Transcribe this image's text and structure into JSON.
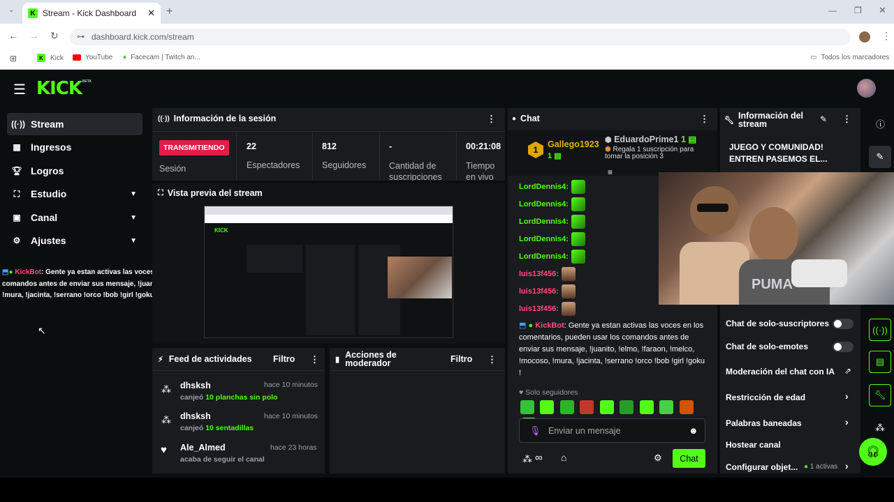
{
  "browser": {
    "tab_title": "Stream - Kick Dashboard",
    "url": "dashboard.kick.com/stream",
    "bookmarks": [
      "Kick",
      "YouTube",
      "Facecam | Twitch an..."
    ],
    "all_bookmarks": "Todos los marcadores"
  },
  "app": {
    "logo": "KICK",
    "logo_badge": "BETA"
  },
  "sidebar": {
    "items": [
      {
        "label": "Stream",
        "icon": "broadcast-icon"
      },
      {
        "label": "Ingresos",
        "icon": "chart-icon"
      },
      {
        "label": "Logros",
        "icon": "trophy-icon"
      },
      {
        "label": "Estudio",
        "icon": "studio-icon"
      },
      {
        "label": "Canal",
        "icon": "channel-icon"
      },
      {
        "label": "Ajustes",
        "icon": "gear-icon"
      }
    ]
  },
  "overlay_message": {
    "user": "KickBot",
    "text": ": Gente ya estan activas las voces en los comentarios, pueden usar los comandos antes de enviar sus mensaje, !juanito, !elmo, !faraon, !melco, !mocoso, !mura, !jacinta, !serrano !orco !bob !girl !goku !"
  },
  "session": {
    "title": "Información de la sesión",
    "status": "TRANSMITIENDO",
    "status_label": "Sesión",
    "stats": [
      {
        "value": "22",
        "label": "Espectadores"
      },
      {
        "value": "812",
        "label": "Seguidores"
      },
      {
        "value": "-",
        "label": "Cantidad de suscripciones"
      },
      {
        "value": "00:21:08",
        "label": "Tiempo en vivo"
      }
    ]
  },
  "preview": {
    "title": "Vista previa del stream"
  },
  "feed": {
    "title": "Feed de actividades",
    "filter": "Filtro",
    "items": [
      {
        "user": "dhsksh",
        "time": "hace 10 minutos",
        "action": "canjeó",
        "reward": "10 planchas sin polo"
      },
      {
        "user": "dhsksh",
        "time": "hace 10 minutos",
        "action": "canjeó",
        "reward": "10 sentadillas"
      },
      {
        "user": "Ale_Almed",
        "time": "hace 23 horas",
        "action": "acaba de seguir el canal",
        "reward": ""
      }
    ]
  },
  "mod_actions": {
    "title": "Acciones de moderador",
    "filter": "Filtro"
  },
  "chat": {
    "title": "Chat",
    "leader1": {
      "rank": "1",
      "name": "Gallego1923",
      "count": "1"
    },
    "leader2": {
      "name": "EduardoPrime1",
      "count": "1",
      "hint": "Regala 1 suscripción para tomar la posición 3"
    },
    "messages": [
      {
        "user": "LordDennis4:",
        "color": "#53fc18"
      },
      {
        "user": "LordDennis4:",
        "color": "#53fc18"
      },
      {
        "user": "LordDennis4:",
        "color": "#53fc18"
      },
      {
        "user": "LordDennis4:",
        "color": "#53fc18"
      },
      {
        "user": "LordDennis4:",
        "color": "#53fc18"
      },
      {
        "user": "luis13f456:",
        "color": "#ff4d7c"
      },
      {
        "user": "luis13f456:",
        "color": "#ff4d7c"
      },
      {
        "user": "luis13f456:",
        "color": "#ff4d7c"
      }
    ],
    "bot_user": "KickBot",
    "bot_text": ": Gente ya estan activas las voces en los comentarios, pueden usar los comandos antes de enviar sus mensaje, !juanito, !elmo, !faraon, !melco, !mocoso, !mura, !jacinta, !serrano !orco !bob !girl !goku !",
    "mode": "Solo seguidores",
    "placeholder": "Enviar un mensaje",
    "send": "Chat"
  },
  "stream_info": {
    "title": "Información del stream",
    "stream_title": "JUEGO Y COMUNIDAD! ENTREN PASEMOS EL..."
  },
  "settings": {
    "subs_only": "Chat de solo-suscriptores",
    "emotes_only": "Chat de solo-emotes",
    "ai_mod": "Moderación del chat con IA",
    "age": "Restricción de edad",
    "banned_words": "Palabras baneadas",
    "host": "Hostear canal",
    "goals": "Configurar objet...",
    "goals_active": "1 activas"
  }
}
